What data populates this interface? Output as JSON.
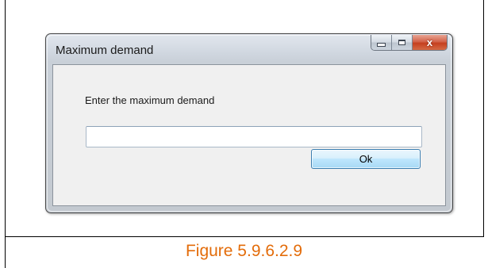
{
  "window": {
    "title": "Maximum demand",
    "prompt": "Enter the maximum demand",
    "input": {
      "value": "",
      "placeholder": ""
    },
    "ok_label": "Ok",
    "caption_icons": [
      "minimize-icon",
      "maximize-icon",
      "close-icon"
    ],
    "close_glyph": "x"
  },
  "figure": {
    "caption": "Figure 5.9.6.2.9",
    "caption_color": "#e36c0a"
  }
}
